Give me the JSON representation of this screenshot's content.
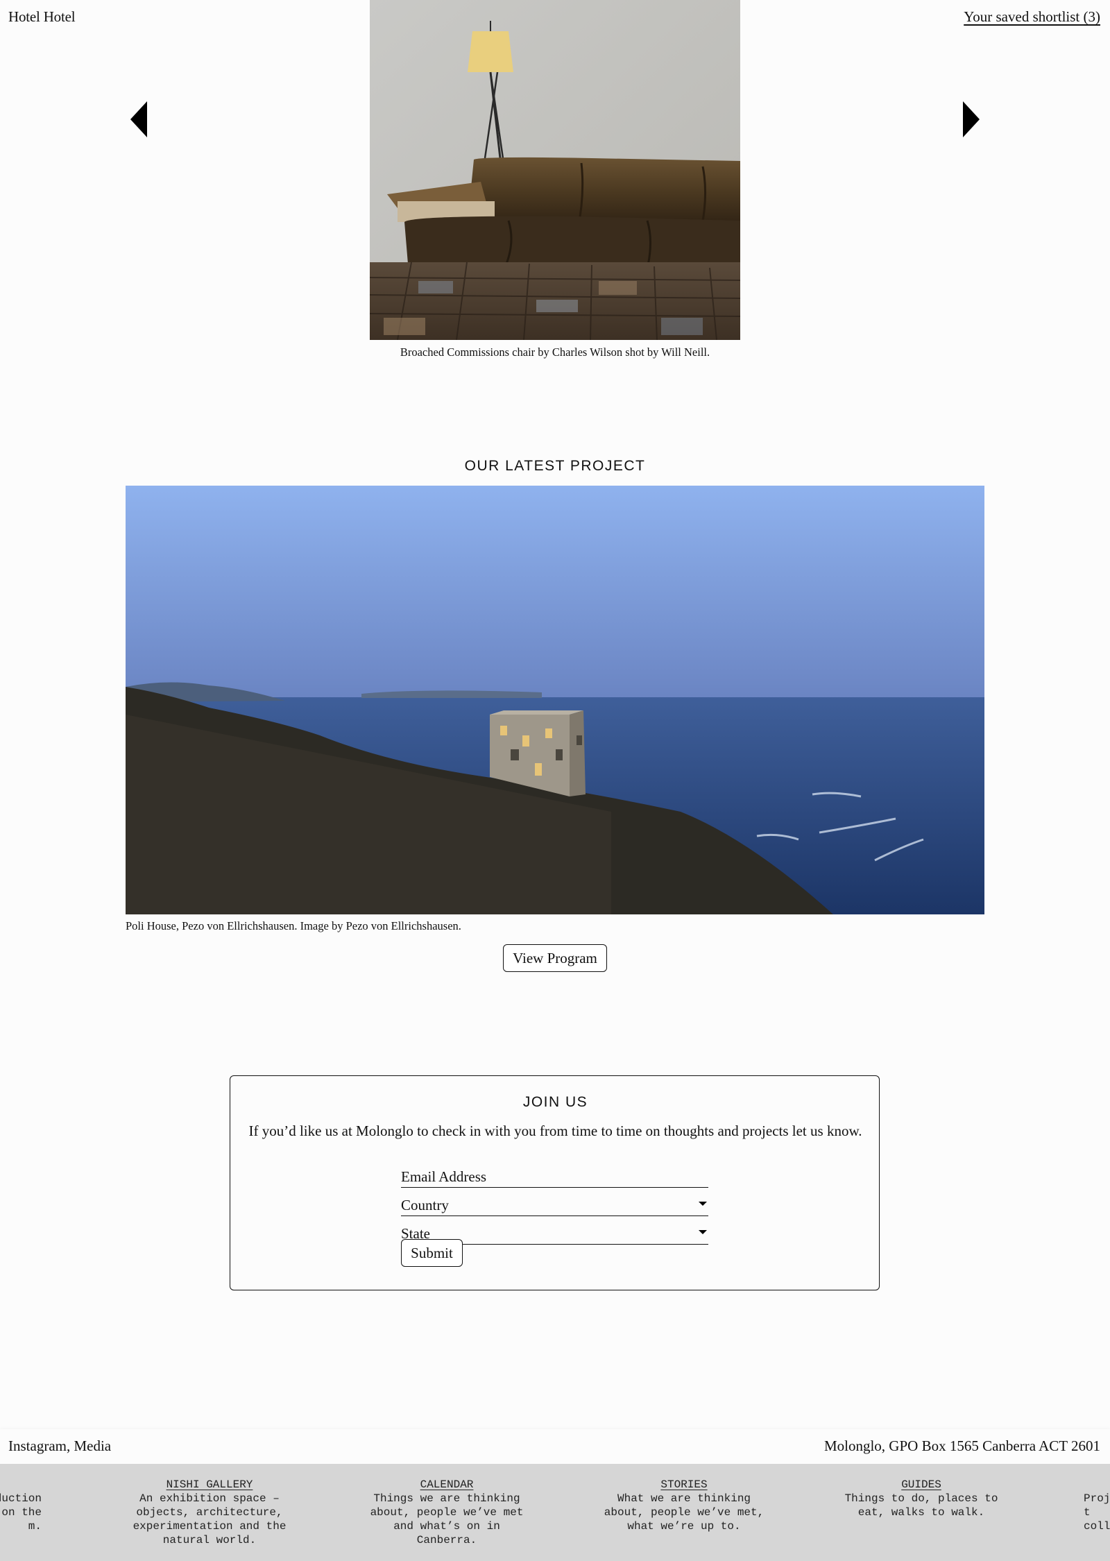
{
  "header": {
    "brand": "Hotel Hotel",
    "shortlist_link": "Your saved shortlist (3)"
  },
  "slider": {
    "caption": "Broached Commissions chair by Charles Wilson shot by Will Neill.",
    "prev_icon": "arrow-left-icon",
    "next_icon": "arrow-right-icon"
  },
  "latest_project": {
    "heading": "OUR LATEST PROJECT",
    "caption": "Poli House, Pezo von Ellrichshausen. Image by Pezo von Ellrichshausen.",
    "button": "View Program"
  },
  "join": {
    "heading": "JOIN US",
    "description": "If you’d like us at Molonglo to check in with you from time to time on thoughts and projects let us know.",
    "email_placeholder": "Email Address",
    "country_label": "Country",
    "state_label": "State",
    "submit": "Submit"
  },
  "footer": {
    "left": "Instagram, Media",
    "right": "Molonglo, GPO Box 1565 Canberra ACT 2601"
  },
  "ticker": {
    "partial_left": "duction\nes on the\nm.",
    "items": [
      {
        "title": "NISHI GALLERY",
        "desc": "An exhibition space –\nobjects, architecture,\nexperimentation and the\nnatural world."
      },
      {
        "title": "CALENDAR",
        "desc": "Things we are thinking\nabout, people we’ve met\nand what’s on in\nCanberra."
      },
      {
        "title": "STORIES",
        "desc": "What we are thinking\nabout, people we’ve met,\nwhat we’re up to."
      },
      {
        "title": "GUIDES",
        "desc": "Things to do, places to\neat, walks to walk."
      }
    ],
    "partial_right": "Proj\nt\ncoll"
  }
}
